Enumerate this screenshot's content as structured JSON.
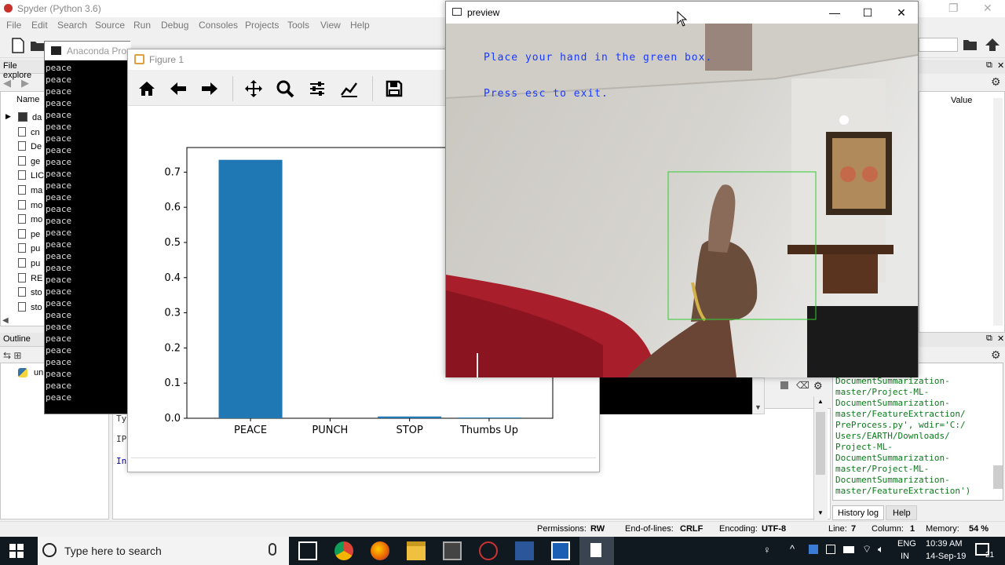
{
  "spyder": {
    "title": "Spyder (Python 3.6)",
    "menu": [
      "File",
      "Edit",
      "Search",
      "Source",
      "Run",
      "Debug",
      "Consoles",
      "Projects",
      "Tools",
      "View",
      "Help"
    ],
    "file_explorer_label": "File explore",
    "name_col": "Name",
    "value_col": "Value",
    "files": [
      "da",
      "cn",
      "De",
      "ge",
      "LIC",
      "ma",
      "mo",
      "mo",
      "pe",
      "pu",
      "pu",
      "RE",
      "sto",
      "sto"
    ],
    "outline_label": "Outline",
    "outline_item": "un",
    "console_lines_left": [
      "Ty",
      "IP:",
      "In"
    ],
    "history_tab": "History log",
    "help_tab": "Help",
    "console_text": "-ML-\nDocumentSummarization-\nmaster/Project-ML-\nDocumentSummarization-\nmaster/FeatureExtraction/\nPreProcess.py', wdir='C:/\nUsers/EARTH/Downloads/\nProject-ML-\nDocumentSummarization-\nmaster/Project-ML-\nDocumentSummarization-\nmaster/FeatureExtraction')",
    "status": {
      "permissions_label": "Permissions:",
      "permissions_value": "RW",
      "eol_label": "End-of-lines:",
      "eol_value": "CRLF",
      "encoding_label": "Encoding:",
      "encoding_value": "UTF-8",
      "line_label": "Line:",
      "line_value": "7",
      "column_label": "Column:",
      "column_value": "1",
      "memory_label": "Memory:",
      "memory_value": "54 %"
    }
  },
  "anaconda": {
    "title": "Anaconda Prom",
    "lines": [
      "peace",
      "peace",
      "peace",
      "peace",
      "peace",
      "peace",
      "peace",
      "peace",
      "peace",
      "peace",
      "peace",
      "peace",
      "peace",
      "peace",
      "peace",
      "peace",
      "peace",
      "peace",
      "peace",
      "peace",
      "peace",
      "peace",
      "peace",
      "peace",
      "peace",
      "peace",
      "peace",
      "peace",
      "peace"
    ]
  },
  "figure": {
    "title": "Figure 1",
    "toolbar_icons": [
      "home-icon",
      "back-arrow-icon",
      "forward-arrow-icon",
      "pan-icon",
      "zoom-icon",
      "configure-subplots-icon",
      "edit-curves-icon",
      "save-icon"
    ]
  },
  "chart_data": {
    "type": "bar",
    "categories": [
      "PEACE",
      "PUNCH",
      "STOP",
      "Thumbs Up"
    ],
    "values": [
      0.735,
      0.0,
      0.005,
      0.002
    ],
    "title": "",
    "xlabel": "",
    "ylabel": "",
    "ylim": [
      0,
      0.77
    ],
    "yticks": [
      "0.0",
      "0.1",
      "0.2",
      "0.3",
      "0.4",
      "0.5",
      "0.6",
      "0.7"
    ],
    "bar_color": "#1f77b4",
    "grid": false
  },
  "preview": {
    "title": "preview",
    "line1": "Place your hand in the green box.",
    "line2": "Press esc to exit.",
    "box_color": "#33cc33"
  },
  "taskbar": {
    "search_placeholder": "Type here to search",
    "lang_top": "ENG",
    "lang_bottom": "IN",
    "time": "10:39 AM",
    "date": "14-Sep-19",
    "notif_count": "21"
  }
}
